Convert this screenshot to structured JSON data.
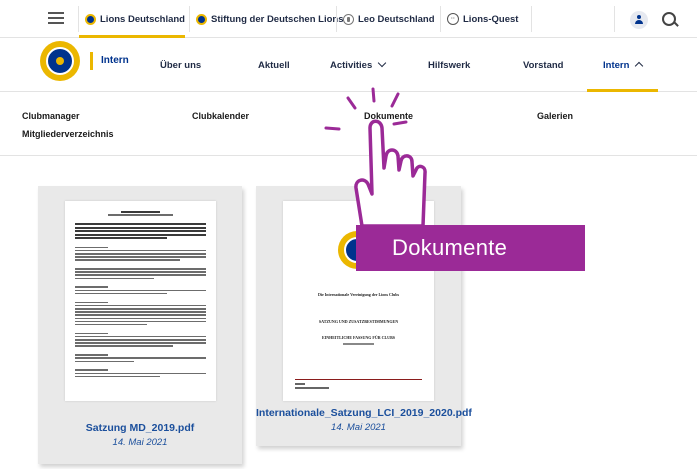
{
  "topbar": {
    "tabs": [
      {
        "label": "Lions Deutschland",
        "icon": "lions-logo-icon",
        "active": true
      },
      {
        "label": "Stiftung der Deutschen Lions",
        "icon": "lions-logo-icon",
        "active": false
      },
      {
        "label": "Leo Deutschland",
        "icon": "leo-logo-icon",
        "active": false
      },
      {
        "label": "Lions-Quest",
        "icon": "lions-quest-icon",
        "active": false
      }
    ],
    "icons": {
      "menu": "hamburger-menu-icon",
      "user": "user-icon",
      "search": "search-icon"
    }
  },
  "mainnav": {
    "brand": "Intern",
    "items": [
      {
        "label": "Über uns"
      },
      {
        "label": "Aktuell"
      },
      {
        "label": "Activities"
      },
      {
        "label": "Hilfswerk"
      },
      {
        "label": "Vorstand"
      },
      {
        "label": "Intern"
      }
    ]
  },
  "subnav": {
    "items": [
      "Clubmanager",
      "Clubkalender",
      "Dokumente",
      "Galerien",
      "Mitgliederverzeichnis"
    ]
  },
  "documents": [
    {
      "filename": "Satzung MD_2019.pdf",
      "date": "14. Mai 2021"
    },
    {
      "filename": "Internationale_Satzung_LCI_2019_2020.pdf",
      "date": "14. Mai 2021"
    }
  ],
  "doc2_preview": {
    "line1": "Die Internationale Vereinigung der Lions Clubs",
    "line2": "SATZUNG UND ZUSATZBESTIMMUNGEN",
    "line3": "EINHEITLICHE FASSUNG FÜR CLUBS"
  },
  "overlay": {
    "label": "Dokumente"
  },
  "colors": {
    "lions_blue": "#00338d",
    "lions_gold": "#ebb700",
    "link_blue": "#1b4f9c",
    "overlay_purple": "#9b2a97"
  }
}
